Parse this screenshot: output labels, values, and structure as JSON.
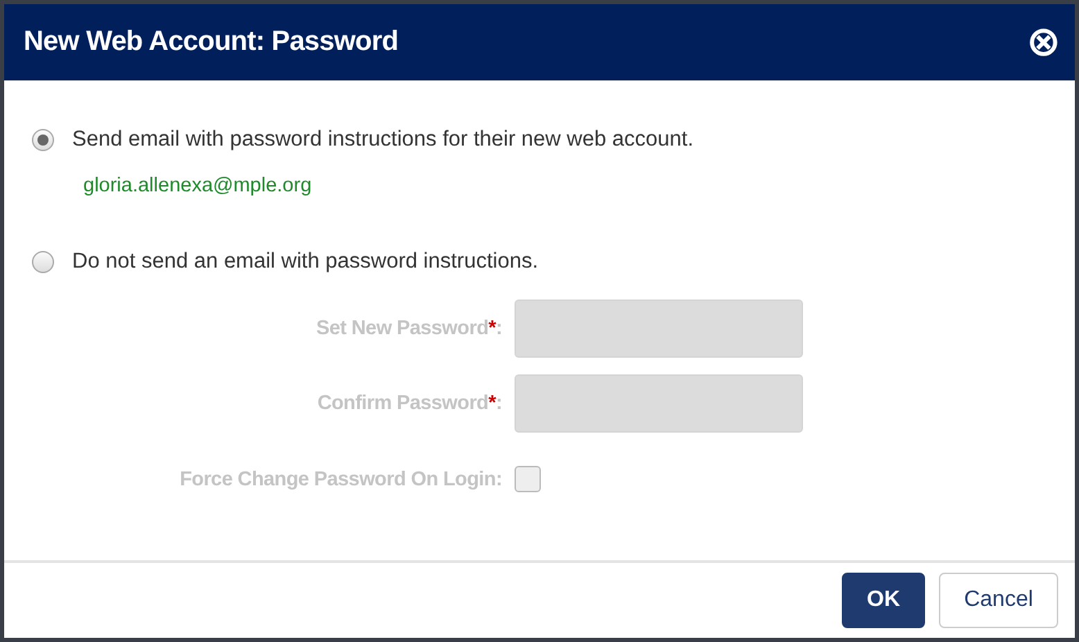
{
  "dialog": {
    "title": "New Web Account: Password",
    "close": "⊗"
  },
  "options": [
    {
      "label": "Send email with password instructions for their new web account.",
      "selected": true,
      "email": "gloria.allenexa@mple.org"
    },
    {
      "label": "Do not send an email with password instructions.",
      "selected": false
    }
  ],
  "fields": [
    {
      "kind": "input",
      "label": "Set New Password",
      "required_mark": "*",
      "suffix": ":",
      "disabled": true
    },
    {
      "kind": "input",
      "label": "Confirm Password",
      "required_mark": "*",
      "suffix": ":",
      "disabled": true
    },
    {
      "kind": "checkbox",
      "label": "Force Change Password On Login",
      "suffix": ":",
      "disabled": true,
      "checked": false
    }
  ],
  "buttons": [
    {
      "label": "OK",
      "kind": "primary"
    },
    {
      "label": "Cancel",
      "kind": "secondary"
    }
  ]
}
